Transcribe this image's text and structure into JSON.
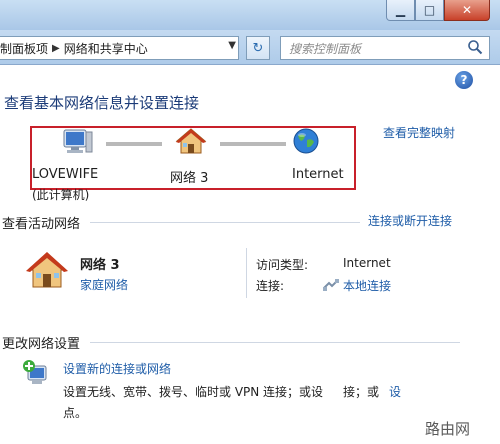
{
  "window": {
    "min_label": "▁",
    "max_label": "□",
    "close_label": "✕"
  },
  "address": {
    "seg1": "制面板项",
    "seg2": "网络和共享中心"
  },
  "search": {
    "placeholder": "搜索控制面板"
  },
  "main": {
    "title": "查看基本网络信息并设置连接",
    "full_map_link": "查看完整映射",
    "map": {
      "computer": "LOVEWIFE",
      "computer_sub": "(此计算机)",
      "network": "网络  3",
      "internet": "Internet"
    },
    "active_heading": "查看活动网络",
    "connect_link": "连接或断开连接",
    "network": {
      "name": "网络  3",
      "type_link": "家庭网络"
    },
    "access_label": "访问类型:",
    "access_value": "Internet",
    "connection_label": "连接:",
    "connection_value": "本地连接",
    "change_heading": "更改网络设置",
    "setup_link": "设置新的连接或网络",
    "setup_desc1": "设置无线、宽带、拨号、临时或 VPN 连接；或设",
    "setup_desc2": "接；或",
    "setup_desc2b": "设",
    "setup_desc3": "点。"
  },
  "watermark": "路由网"
}
